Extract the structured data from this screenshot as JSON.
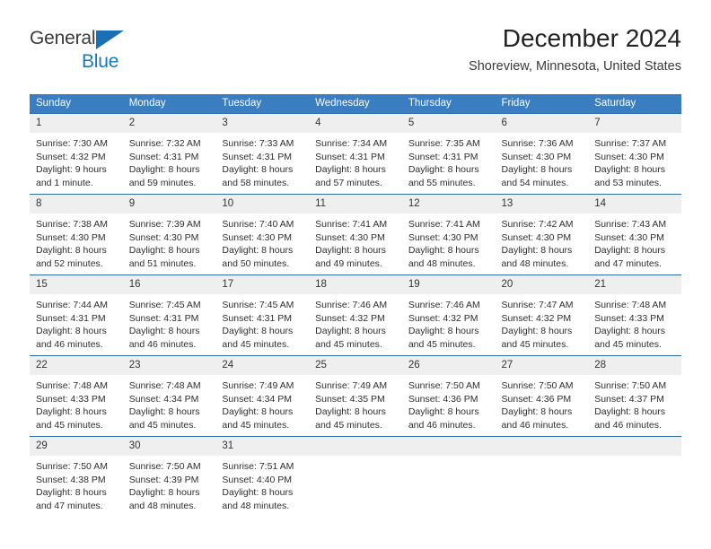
{
  "brand": {
    "name_top": "General",
    "name_bottom": "Blue",
    "accent_color": "#1479c4",
    "triangle_color": "#1a6fb5"
  },
  "header": {
    "title": "December 2024",
    "subtitle": "Shoreview, Minnesota, United States"
  },
  "theme": {
    "header_bg": "#3a7dc0",
    "header_text": "#ffffff",
    "daynum_bg": "#efefef",
    "cell_border": "#2f6da8",
    "body_text": "#2e2e2e"
  },
  "weekday_headers": [
    "Sunday",
    "Monday",
    "Tuesday",
    "Wednesday",
    "Thursday",
    "Friday",
    "Saturday"
  ],
  "weeks": [
    {
      "days": [
        {
          "num": "1",
          "sunrise": "Sunrise: 7:30 AM",
          "sunset": "Sunset: 4:32 PM",
          "daylight1": "Daylight: 9 hours",
          "daylight2": "and 1 minute."
        },
        {
          "num": "2",
          "sunrise": "Sunrise: 7:32 AM",
          "sunset": "Sunset: 4:31 PM",
          "daylight1": "Daylight: 8 hours",
          "daylight2": "and 59 minutes."
        },
        {
          "num": "3",
          "sunrise": "Sunrise: 7:33 AM",
          "sunset": "Sunset: 4:31 PM",
          "daylight1": "Daylight: 8 hours",
          "daylight2": "and 58 minutes."
        },
        {
          "num": "4",
          "sunrise": "Sunrise: 7:34 AM",
          "sunset": "Sunset: 4:31 PM",
          "daylight1": "Daylight: 8 hours",
          "daylight2": "and 57 minutes."
        },
        {
          "num": "5",
          "sunrise": "Sunrise: 7:35 AM",
          "sunset": "Sunset: 4:31 PM",
          "daylight1": "Daylight: 8 hours",
          "daylight2": "and 55 minutes."
        },
        {
          "num": "6",
          "sunrise": "Sunrise: 7:36 AM",
          "sunset": "Sunset: 4:30 PM",
          "daylight1": "Daylight: 8 hours",
          "daylight2": "and 54 minutes."
        },
        {
          "num": "7",
          "sunrise": "Sunrise: 7:37 AM",
          "sunset": "Sunset: 4:30 PM",
          "daylight1": "Daylight: 8 hours",
          "daylight2": "and 53 minutes."
        }
      ]
    },
    {
      "days": [
        {
          "num": "8",
          "sunrise": "Sunrise: 7:38 AM",
          "sunset": "Sunset: 4:30 PM",
          "daylight1": "Daylight: 8 hours",
          "daylight2": "and 52 minutes."
        },
        {
          "num": "9",
          "sunrise": "Sunrise: 7:39 AM",
          "sunset": "Sunset: 4:30 PM",
          "daylight1": "Daylight: 8 hours",
          "daylight2": "and 51 minutes."
        },
        {
          "num": "10",
          "sunrise": "Sunrise: 7:40 AM",
          "sunset": "Sunset: 4:30 PM",
          "daylight1": "Daylight: 8 hours",
          "daylight2": "and 50 minutes."
        },
        {
          "num": "11",
          "sunrise": "Sunrise: 7:41 AM",
          "sunset": "Sunset: 4:30 PM",
          "daylight1": "Daylight: 8 hours",
          "daylight2": "and 49 minutes."
        },
        {
          "num": "12",
          "sunrise": "Sunrise: 7:41 AM",
          "sunset": "Sunset: 4:30 PM",
          "daylight1": "Daylight: 8 hours",
          "daylight2": "and 48 minutes."
        },
        {
          "num": "13",
          "sunrise": "Sunrise: 7:42 AM",
          "sunset": "Sunset: 4:30 PM",
          "daylight1": "Daylight: 8 hours",
          "daylight2": "and 48 minutes."
        },
        {
          "num": "14",
          "sunrise": "Sunrise: 7:43 AM",
          "sunset": "Sunset: 4:30 PM",
          "daylight1": "Daylight: 8 hours",
          "daylight2": "and 47 minutes."
        }
      ]
    },
    {
      "days": [
        {
          "num": "15",
          "sunrise": "Sunrise: 7:44 AM",
          "sunset": "Sunset: 4:31 PM",
          "daylight1": "Daylight: 8 hours",
          "daylight2": "and 46 minutes."
        },
        {
          "num": "16",
          "sunrise": "Sunrise: 7:45 AM",
          "sunset": "Sunset: 4:31 PM",
          "daylight1": "Daylight: 8 hours",
          "daylight2": "and 46 minutes."
        },
        {
          "num": "17",
          "sunrise": "Sunrise: 7:45 AM",
          "sunset": "Sunset: 4:31 PM",
          "daylight1": "Daylight: 8 hours",
          "daylight2": "and 45 minutes."
        },
        {
          "num": "18",
          "sunrise": "Sunrise: 7:46 AM",
          "sunset": "Sunset: 4:32 PM",
          "daylight1": "Daylight: 8 hours",
          "daylight2": "and 45 minutes."
        },
        {
          "num": "19",
          "sunrise": "Sunrise: 7:46 AM",
          "sunset": "Sunset: 4:32 PM",
          "daylight1": "Daylight: 8 hours",
          "daylight2": "and 45 minutes."
        },
        {
          "num": "20",
          "sunrise": "Sunrise: 7:47 AM",
          "sunset": "Sunset: 4:32 PM",
          "daylight1": "Daylight: 8 hours",
          "daylight2": "and 45 minutes."
        },
        {
          "num": "21",
          "sunrise": "Sunrise: 7:48 AM",
          "sunset": "Sunset: 4:33 PM",
          "daylight1": "Daylight: 8 hours",
          "daylight2": "and 45 minutes."
        }
      ]
    },
    {
      "days": [
        {
          "num": "22",
          "sunrise": "Sunrise: 7:48 AM",
          "sunset": "Sunset: 4:33 PM",
          "daylight1": "Daylight: 8 hours",
          "daylight2": "and 45 minutes."
        },
        {
          "num": "23",
          "sunrise": "Sunrise: 7:48 AM",
          "sunset": "Sunset: 4:34 PM",
          "daylight1": "Daylight: 8 hours",
          "daylight2": "and 45 minutes."
        },
        {
          "num": "24",
          "sunrise": "Sunrise: 7:49 AM",
          "sunset": "Sunset: 4:34 PM",
          "daylight1": "Daylight: 8 hours",
          "daylight2": "and 45 minutes."
        },
        {
          "num": "25",
          "sunrise": "Sunrise: 7:49 AM",
          "sunset": "Sunset: 4:35 PM",
          "daylight1": "Daylight: 8 hours",
          "daylight2": "and 45 minutes."
        },
        {
          "num": "26",
          "sunrise": "Sunrise: 7:50 AM",
          "sunset": "Sunset: 4:36 PM",
          "daylight1": "Daylight: 8 hours",
          "daylight2": "and 46 minutes."
        },
        {
          "num": "27",
          "sunrise": "Sunrise: 7:50 AM",
          "sunset": "Sunset: 4:36 PM",
          "daylight1": "Daylight: 8 hours",
          "daylight2": "and 46 minutes."
        },
        {
          "num": "28",
          "sunrise": "Sunrise: 7:50 AM",
          "sunset": "Sunset: 4:37 PM",
          "daylight1": "Daylight: 8 hours",
          "daylight2": "and 46 minutes."
        }
      ]
    },
    {
      "days": [
        {
          "num": "29",
          "sunrise": "Sunrise: 7:50 AM",
          "sunset": "Sunset: 4:38 PM",
          "daylight1": "Daylight: 8 hours",
          "daylight2": "and 47 minutes."
        },
        {
          "num": "30",
          "sunrise": "Sunrise: 7:50 AM",
          "sunset": "Sunset: 4:39 PM",
          "daylight1": "Daylight: 8 hours",
          "daylight2": "and 48 minutes."
        },
        {
          "num": "31",
          "sunrise": "Sunrise: 7:51 AM",
          "sunset": "Sunset: 4:40 PM",
          "daylight1": "Daylight: 8 hours",
          "daylight2": "and 48 minutes."
        },
        {
          "num": "",
          "sunrise": "",
          "sunset": "",
          "daylight1": "",
          "daylight2": ""
        },
        {
          "num": "",
          "sunrise": "",
          "sunset": "",
          "daylight1": "",
          "daylight2": ""
        },
        {
          "num": "",
          "sunrise": "",
          "sunset": "",
          "daylight1": "",
          "daylight2": ""
        },
        {
          "num": "",
          "sunrise": "",
          "sunset": "",
          "daylight1": "",
          "daylight2": ""
        }
      ]
    }
  ]
}
